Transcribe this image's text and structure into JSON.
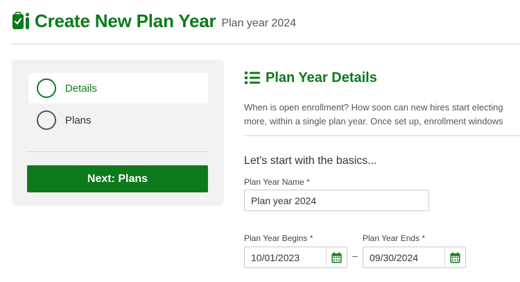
{
  "header": {
    "title": "Create New Plan Year",
    "subtitle": "Plan year 2024",
    "logo_icon": "clipboard-check-icon"
  },
  "sidebar": {
    "steps": [
      {
        "label": "Details",
        "active": true
      },
      {
        "label": "Plans",
        "active": false
      }
    ],
    "next_button_label": "Next: Plans"
  },
  "main": {
    "section_icon": "list-icon",
    "section_title": "Plan Year Details",
    "description_line1": "When is open enrollment? How soon can new hires start electing",
    "description_line2": "more, within a single plan year. Once set up, enrollment windows",
    "basics_heading": "Let's start with the basics...",
    "plan_year_name": {
      "label": "Plan Year Name",
      "required_mark": "*",
      "value": "Plan year 2024"
    },
    "plan_year_begins": {
      "label": "Plan Year Begins",
      "required_mark": "*",
      "value": "10/01/2023"
    },
    "date_separator": "–",
    "plan_year_ends": {
      "label": "Plan Year Ends",
      "required_mark": "*",
      "value": "09/30/2024"
    },
    "calendar_icon": "calendar-icon"
  },
  "colors": {
    "brand_green": "#0d7a1b",
    "panel_bg": "#f2f2f2"
  }
}
